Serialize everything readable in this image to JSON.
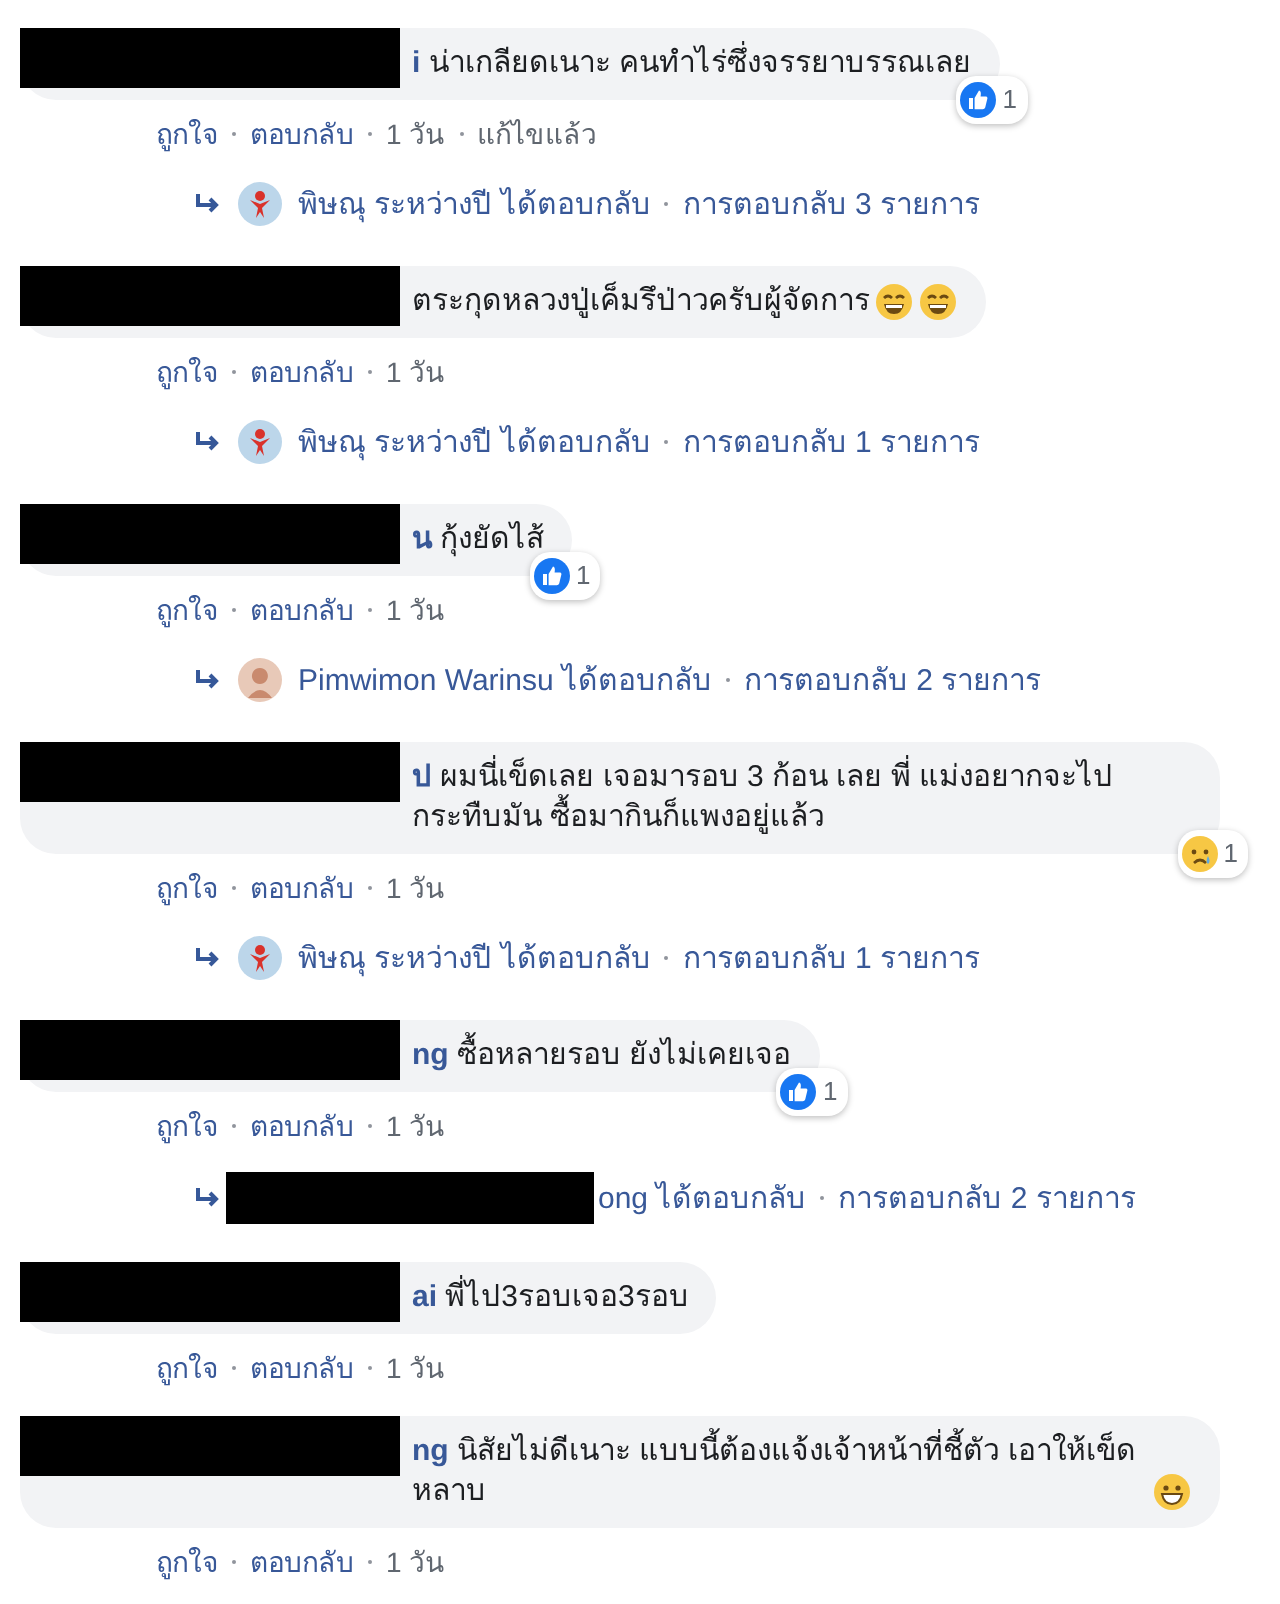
{
  "comments": [
    {
      "text": "**i** น่าเกลียดเนาะ คนทำไร่ซึ่งจรรยาบรรณเลย",
      "reaction": {
        "kind": "like",
        "count": "1"
      },
      "actions": [
        "ถูกใจ",
        "ตอบกลับ",
        "1 วัน",
        "แก้ไขแล้ว"
      ],
      "replies": {
        "name": "พิษณุ ระหว่างปี",
        "verb": "ได้ตอบกลับ",
        "count": "การตอบกลับ 3 รายการ",
        "redacted": false
      }
    },
    {
      "text": "ตระกุดหลวงปู่เค็มรึป่าวครับผู้จัดการ",
      "emojis": [
        {
          "kind": "laughing"
        },
        {
          "kind": "laughing"
        }
      ],
      "actions": [
        "ถูกใจ",
        "ตอบกลับ",
        "1 วัน"
      ],
      "replies": {
        "name": "พิษณุ ระหว่างปี",
        "verb": "ได้ตอบกลับ",
        "count": "การตอบกลับ 1 รายการ",
        "redacted": false
      }
    },
    {
      "text": "**น** กุ้งยัดไส้",
      "reaction": {
        "kind": "like",
        "count": "1"
      },
      "actions": [
        "ถูกใจ",
        "ตอบกลับ",
        "1 วัน"
      ],
      "replies": {
        "name": "Pimwimon Warinsu",
        "verb": "ได้ตอบกลับ",
        "count": "การตอบกลับ 2 รายการ",
        "redacted": false
      }
    },
    {
      "text": "**ป** ผมนี่เข็ดเลย เจอมารอบ 3 ก้อน เลย พี่ แม่งอยากจะไปกระทืบมัน ซื้อมากินก็แพงอยู่แล้ว",
      "reaction": {
        "kind": "sad",
        "count": "1"
      },
      "actions": [
        "ถูกใจ",
        "ตอบกลับ",
        "1 วัน"
      ],
      "replies": {
        "name": "พิษณุ ระหว่างปี",
        "verb": "ได้ตอบกลับ",
        "count": "การตอบกลับ 1 รายการ",
        "redacted": false
      }
    },
    {
      "text": "**ng** ซื้อหลายรอบ ยังไม่เคยเจอ",
      "reaction": {
        "kind": "like",
        "count": "1"
      },
      "actions": [
        "ถูกใจ",
        "ตอบกลับ",
        "1 วัน"
      ],
      "replies": {
        "name": "ong",
        "verb": "ได้ตอบกลับ",
        "count": "การตอบกลับ 2 รายการ",
        "redacted": true
      }
    },
    {
      "text": "**ai** พี่ไป3รอบเจอ3รอบ",
      "actions": [
        "ถูกใจ",
        "ตอบกลับ",
        "1 วัน"
      ]
    },
    {
      "text": "**ng** นิสัยไม่ดีเนาะ แบบนี้ต้องแจ้งเจ้าหน้าที่ชี้ตัว เอาให้เข็ดหลาบ",
      "emojis": [
        {
          "kind": "grinning"
        }
      ],
      "actions": [
        "ถูกใจ",
        "ตอบกลับ",
        "1 วัน"
      ]
    }
  ]
}
